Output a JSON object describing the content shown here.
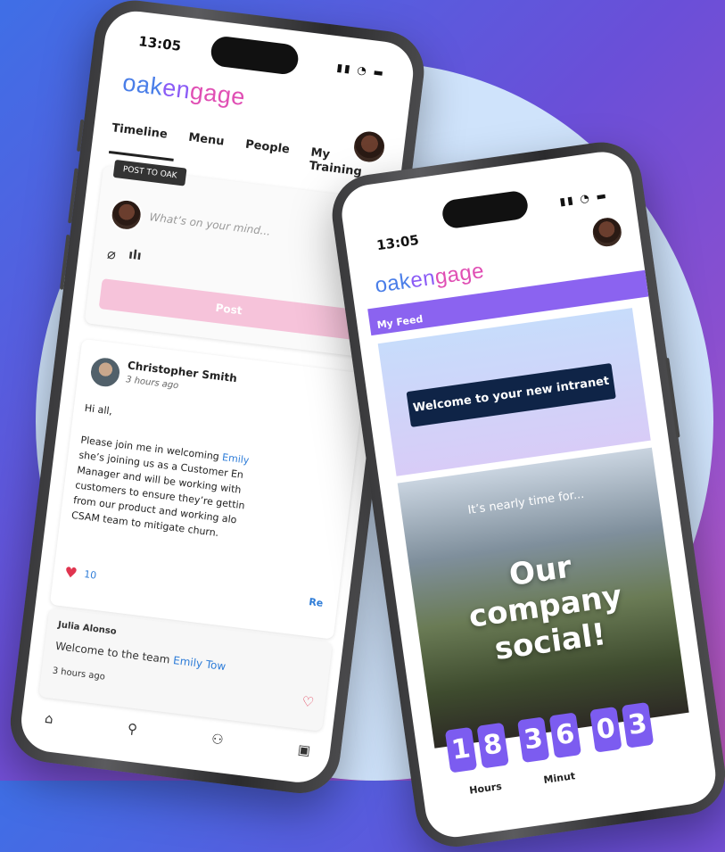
{
  "brand": {
    "colors": {
      "blue": "#4a7ee8",
      "purple": "#8b5cf6",
      "pink": "#e04fb4",
      "navy": "#0f2447"
    }
  },
  "phone_back": {
    "time": "13:05",
    "logo": {
      "part1": "oak",
      "part2": "en",
      "part3": "gage"
    },
    "tabs": [
      "Timeline",
      "Menu",
      "People",
      "My Training"
    ],
    "post_label": "POST TO OAK",
    "post_placeholder": "What’s on your mind...",
    "post_button": "Post",
    "post": {
      "author": "Christopher Smith",
      "time": "3 hours ago",
      "greeting": "Hi all,",
      "body_prefix": "Please join me in welcoming ",
      "body_link": "Emily",
      "body_rest": "she’s joining us as a Customer En\nManager and will be working with\ncustomers to ensure they’re gettin\nfrom our product and working alo\nCSAM team to mitigate churn.",
      "likes": "10",
      "reply_link": "Re"
    },
    "comment": {
      "author": "Julia Alonso",
      "text_prefix": "Welcome to the team ",
      "text_link": "Emily Tow",
      "time": "3 hours ago"
    },
    "nav_icons": [
      "home-icon",
      "search-icon",
      "people-icon",
      "chat-icon"
    ]
  },
  "phone_front": {
    "time": "13:05",
    "logo": {
      "part1": "oak",
      "part2": "en",
      "part3": "gage"
    },
    "feed_title": "My Feed",
    "welcome_banner": "Welcome to your new intranet",
    "promo_sub": "It’s nearly time for...",
    "promo_title": "Our company social!",
    "countdown_digits": [
      "1",
      "8",
      "3",
      "6",
      "0",
      "3"
    ],
    "countdown_labels": [
      "Hours",
      "Minut"
    ]
  }
}
